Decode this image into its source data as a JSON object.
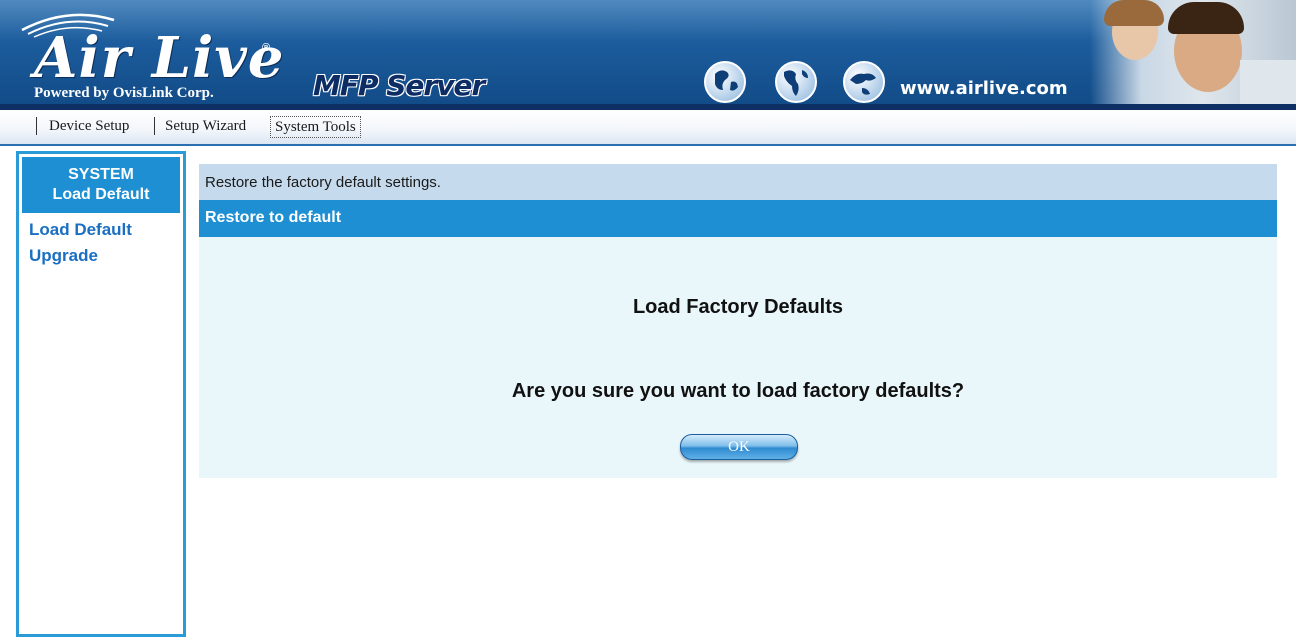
{
  "header": {
    "logo_text": "Air Live",
    "logo_reg": "®",
    "powered_by": "Powered by OvisLink Corp.",
    "product": "MFP Server",
    "url": "www.airlive.com",
    "icons": [
      "globe-icon",
      "globe-icon",
      "globe-icon"
    ]
  },
  "nav": {
    "items": [
      {
        "label": "Device Setup"
      },
      {
        "label": "Setup Wizard"
      },
      {
        "label": "System Tools",
        "active": true
      }
    ]
  },
  "sidebar": {
    "head_line1": "SYSTEM",
    "head_line2": "Load Default",
    "links": [
      {
        "label": "Load Default"
      },
      {
        "label": "Upgrade"
      }
    ]
  },
  "main": {
    "description": "Restore the factory default settings.",
    "section_title": "Restore to default",
    "heading": "Load Factory Defaults",
    "question": "Are you sure you want to load factory defaults?",
    "ok_label": "OK"
  },
  "colors": {
    "header_blue": "#1b5a9a",
    "accent_blue": "#1e8fd3",
    "link_blue": "#1b6fc2",
    "content_bg": "#e9f7fb",
    "desc_bar": "#c5dbed"
  }
}
